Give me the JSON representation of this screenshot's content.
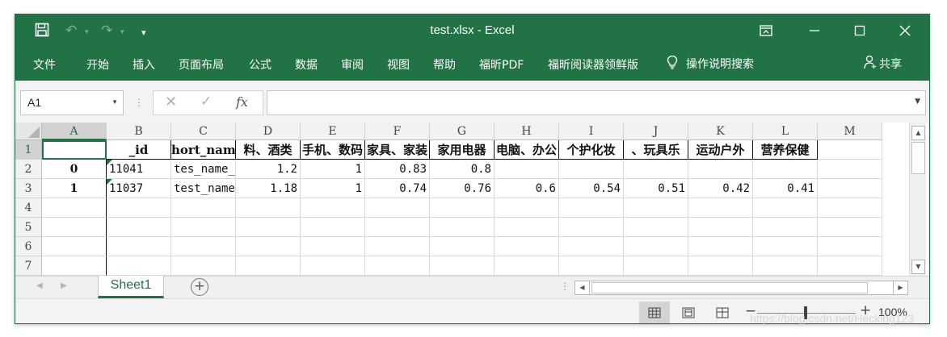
{
  "window": {
    "title": "test.xlsx  -  Excel",
    "quick_access": {
      "save_icon": "save-icon",
      "undo_icon": "undo-icon",
      "redo_icon": "redo-icon",
      "customize_icon": "customize-quick-access-icon"
    },
    "controls": {
      "ribbon_options_icon": "ribbon-display-options-icon",
      "minimize_icon": "minimize-icon",
      "maximize_icon": "maximize-icon",
      "close_icon": "close-icon"
    }
  },
  "menu": {
    "tabs": [
      "文件",
      "开始",
      "插入",
      "页面布局",
      "公式",
      "数据",
      "审阅",
      "视图",
      "帮助",
      "福昕PDF",
      "福昕阅读器领鲜版"
    ],
    "tell_me": "操作说明搜索",
    "share": "共享"
  },
  "formula_bar": {
    "name_box": "A1",
    "cancel_glyph": "✕",
    "enter_glyph": "✓",
    "insert_function_label": "fx",
    "formula": ""
  },
  "grid": {
    "column_headers": [
      "A",
      "B",
      "C",
      "D",
      "E",
      "F",
      "G",
      "H",
      "I",
      "J",
      "K",
      "L",
      "M"
    ],
    "selected_column": "A",
    "row_headers": [
      "1",
      "2",
      "3",
      "4",
      "5",
      "6",
      "7"
    ],
    "selected_row": "1",
    "rows": [
      [
        "",
        "_id",
        "hort_nam",
        "料、酒类",
        "手机、数码",
        "家具、家装",
        "家用电器",
        "电脑、办公",
        "个护化妆",
        "、玩具乐",
        "运动户外",
        "营养保健",
        ""
      ],
      [
        "0",
        "11041",
        "tes_name_",
        "1.2",
        "1",
        "0.83",
        "0.8",
        "",
        "",
        "",
        "",
        "",
        ""
      ],
      [
        "1",
        "11037",
        "test_name",
        "1.18",
        "1",
        "0.74",
        "0.76",
        "0.6",
        "0.54",
        "0.51",
        "0.42",
        "0.41",
        ""
      ],
      [
        "",
        "",
        "",
        "",
        "",
        "",
        "",
        "",
        "",
        "",
        "",
        "",
        ""
      ],
      [
        "",
        "",
        "",
        "",
        "",
        "",
        "",
        "",
        "",
        "",
        "",
        "",
        ""
      ],
      [
        "",
        "",
        "",
        "",
        "",
        "",
        "",
        "",
        "",
        "",
        "",
        "",
        ""
      ],
      [
        "",
        "",
        "",
        "",
        "",
        "",
        "",
        "",
        "",
        "",
        "",
        "",
        ""
      ]
    ]
  },
  "sheets": {
    "tabs": [
      "Sheet1"
    ],
    "active": "Sheet1",
    "add_icon": "add-sheet-icon"
  },
  "status_bar": {
    "zoom_level": "100%",
    "view_icons": [
      "normal-view-icon",
      "page-layout-view-icon",
      "page-break-preview-icon"
    ]
  },
  "watermark": "https://blog.csdn.net/Hecking123",
  "colors": {
    "accent": "#217346",
    "selection": "#217346"
  }
}
